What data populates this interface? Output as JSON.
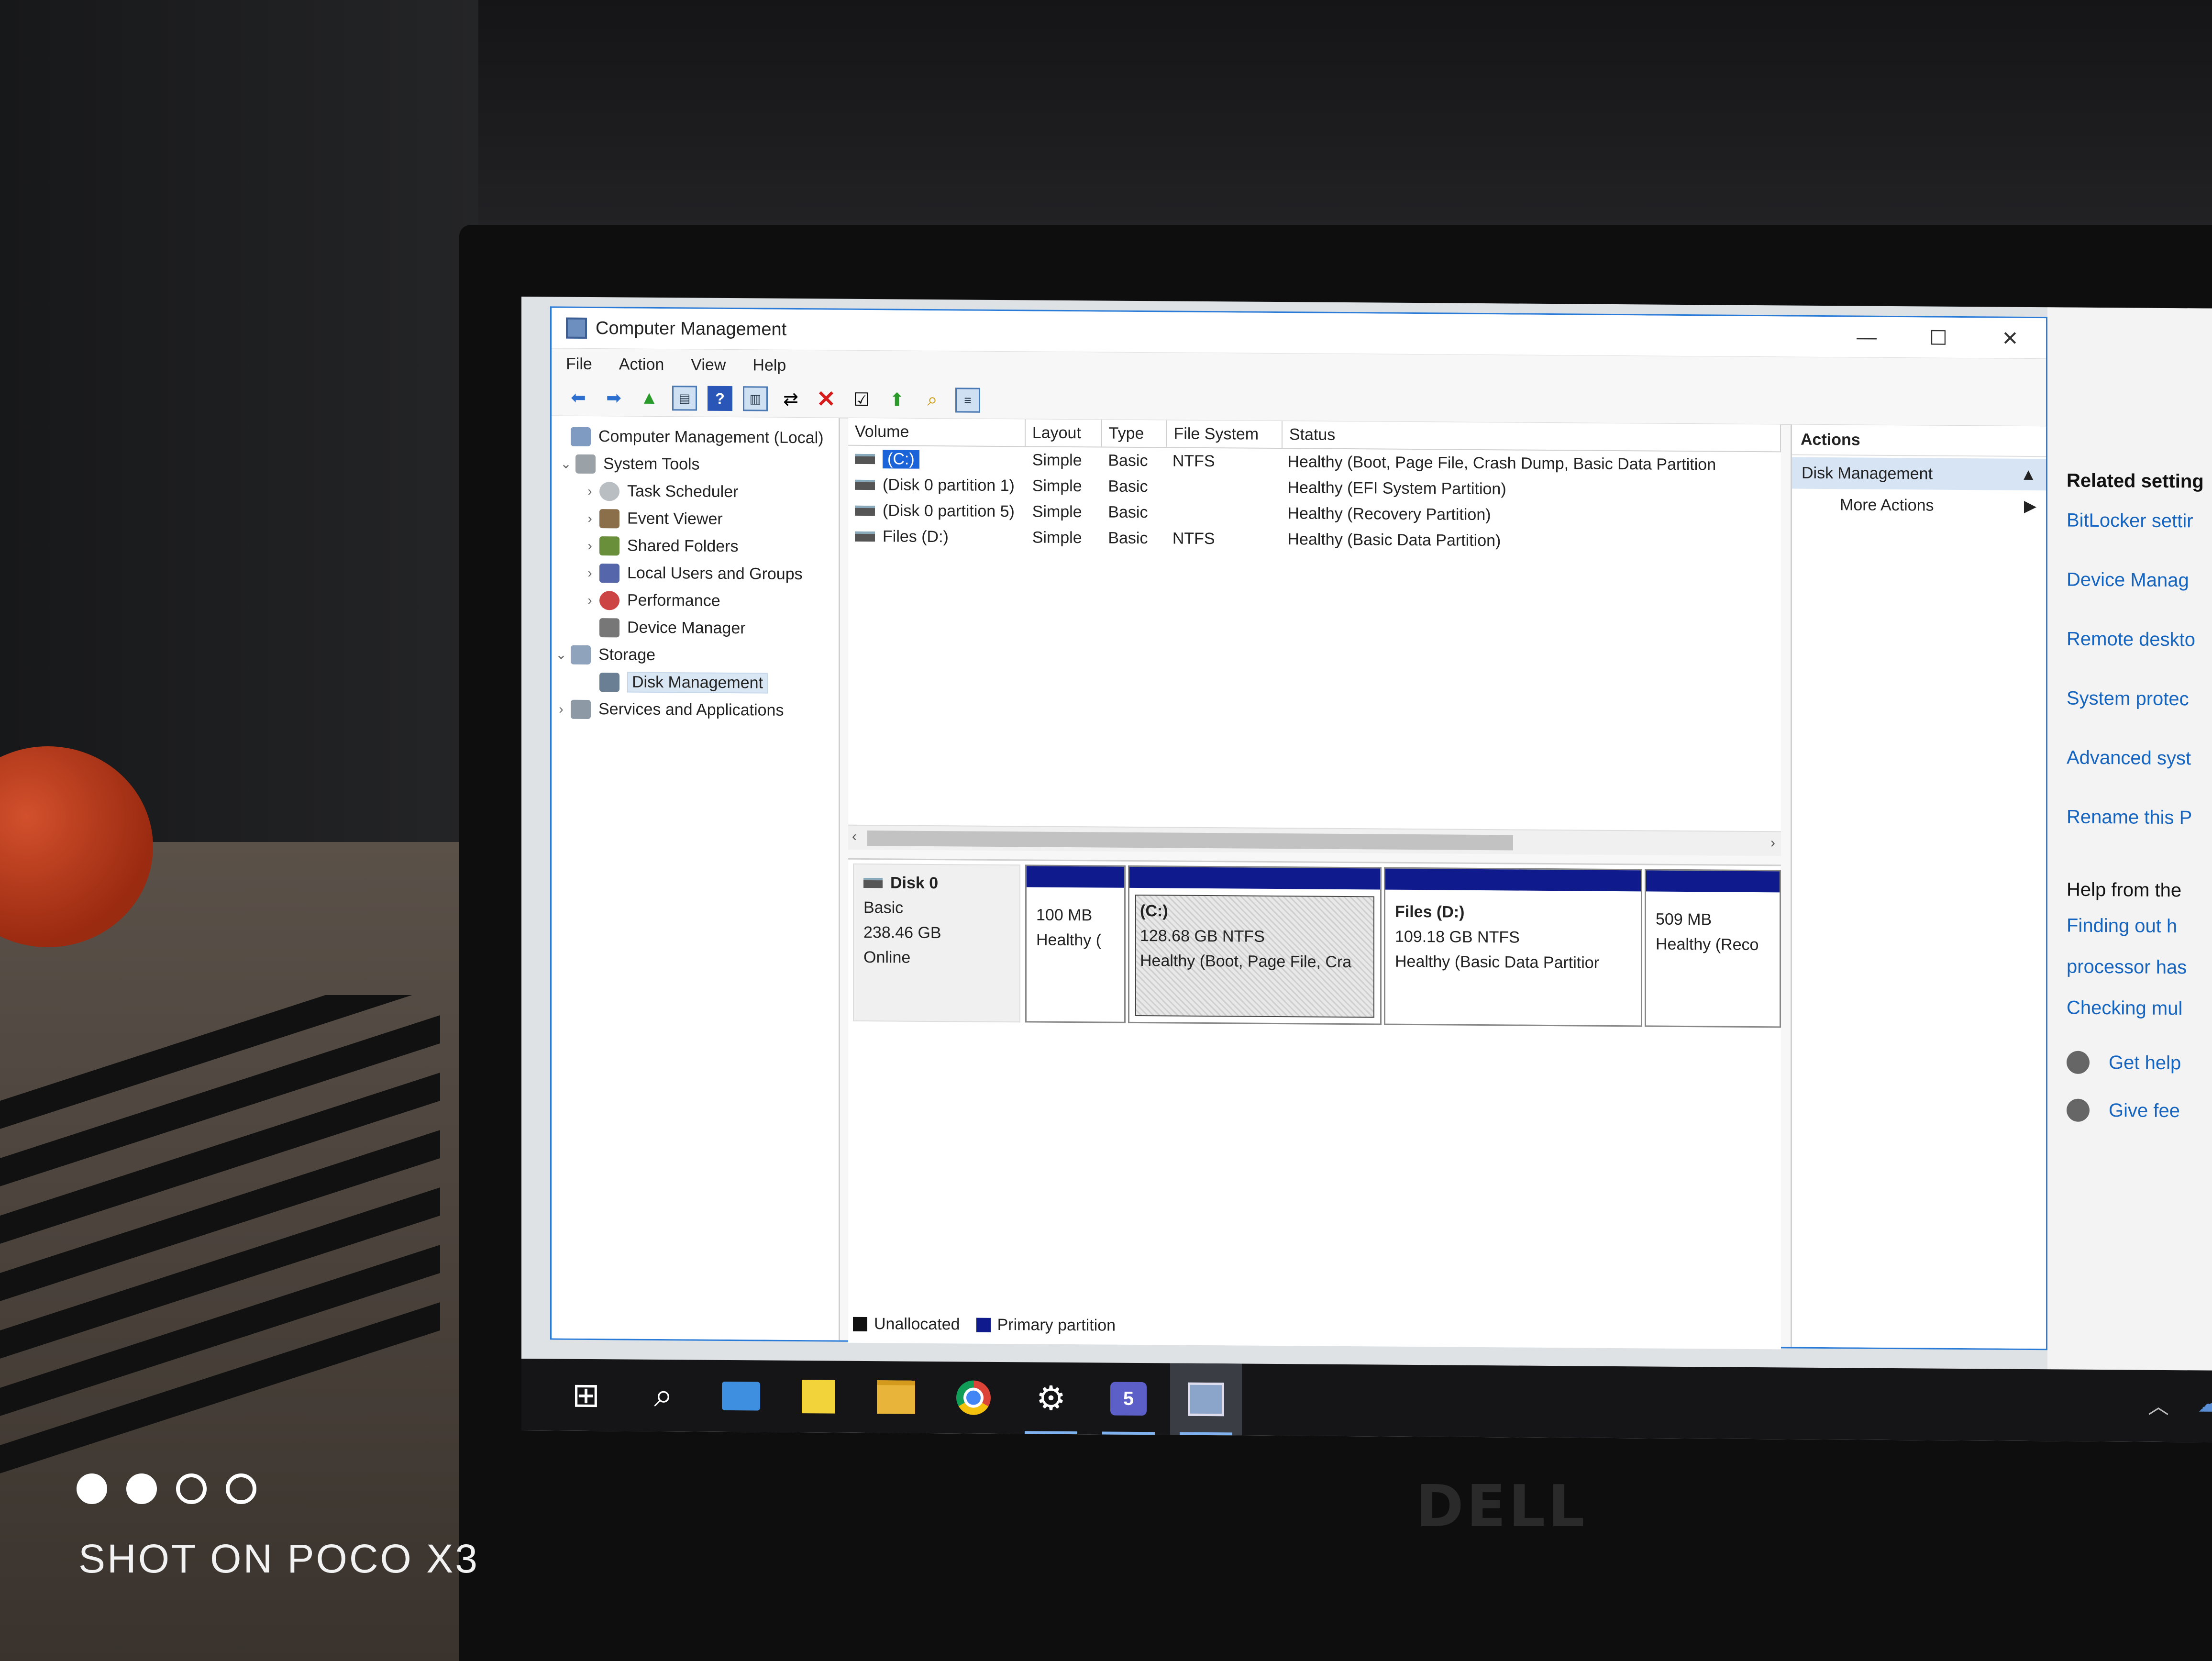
{
  "camera": {
    "watermark": "SHOT ON POCO X3"
  },
  "laptop": {
    "brand": "DELL"
  },
  "window": {
    "title": "Computer Management",
    "controls": {
      "minimize": "—",
      "maximize": "☐",
      "close": "✕"
    }
  },
  "menu": [
    "File",
    "Action",
    "View",
    "Help"
  ],
  "tree": {
    "root": "Computer Management (Local)",
    "system_tools": "System Tools",
    "task_scheduler": "Task Scheduler",
    "event_viewer": "Event Viewer",
    "shared_folders": "Shared Folders",
    "local_users": "Local Users and Groups",
    "performance": "Performance",
    "device_manager": "Device Manager",
    "storage": "Storage",
    "disk_management": "Disk Management",
    "services": "Services and Applications"
  },
  "volume_table": {
    "columns": [
      "Volume",
      "Layout",
      "Type",
      "File System",
      "Status"
    ],
    "rows": [
      {
        "volume": "(C:)",
        "layout": "Simple",
        "type": "Basic",
        "fs": "NTFS",
        "status": "Healthy (Boot, Page File, Crash Dump, Basic Data Partition"
      },
      {
        "volume": "(Disk 0 partition 1)",
        "layout": "Simple",
        "type": "Basic",
        "fs": "",
        "status": "Healthy (EFI System Partition)"
      },
      {
        "volume": "(Disk 0 partition 5)",
        "layout": "Simple",
        "type": "Basic",
        "fs": "",
        "status": "Healthy (Recovery Partition)"
      },
      {
        "volume": "Files (D:)",
        "layout": "Simple",
        "type": "Basic",
        "fs": "NTFS",
        "status": "Healthy (Basic Data Partition)"
      }
    ]
  },
  "disk": {
    "name": "Disk 0",
    "type": "Basic",
    "size": "238.46 GB",
    "state": "Online",
    "partitions": [
      {
        "name": "",
        "size": "100 MB",
        "status": "Healthy ("
      },
      {
        "name": "(C:)",
        "size": "128.68 GB NTFS",
        "status": "Healthy (Boot, Page File, Cra"
      },
      {
        "name": "Files  (D:)",
        "size": "109.18 GB NTFS",
        "status": "Healthy (Basic Data Partitior"
      },
      {
        "name": "",
        "size": "509 MB",
        "status": "Healthy (Reco"
      }
    ]
  },
  "legend": {
    "unallocated": "Unallocated",
    "primary": "Primary partition"
  },
  "actions": {
    "header": "Actions",
    "section": "Disk Management",
    "more": "More Actions"
  },
  "settings_panel": {
    "related_header": "Related setting",
    "links": [
      "BitLocker settir",
      "Device Manag",
      "Remote deskto",
      "System protec",
      "Advanced syst",
      "Rename this P"
    ],
    "help_header": "Help from the",
    "help_links": [
      "Finding out h",
      "processor has",
      "Checking mul"
    ],
    "get_help": "Get help",
    "give_feedback": "Give fee"
  },
  "taskbar": {
    "teams_badge": "5"
  },
  "colors": {
    "primary_partition": "#0f1b8c",
    "selection": "#1a63d8",
    "link": "#1565c0"
  }
}
